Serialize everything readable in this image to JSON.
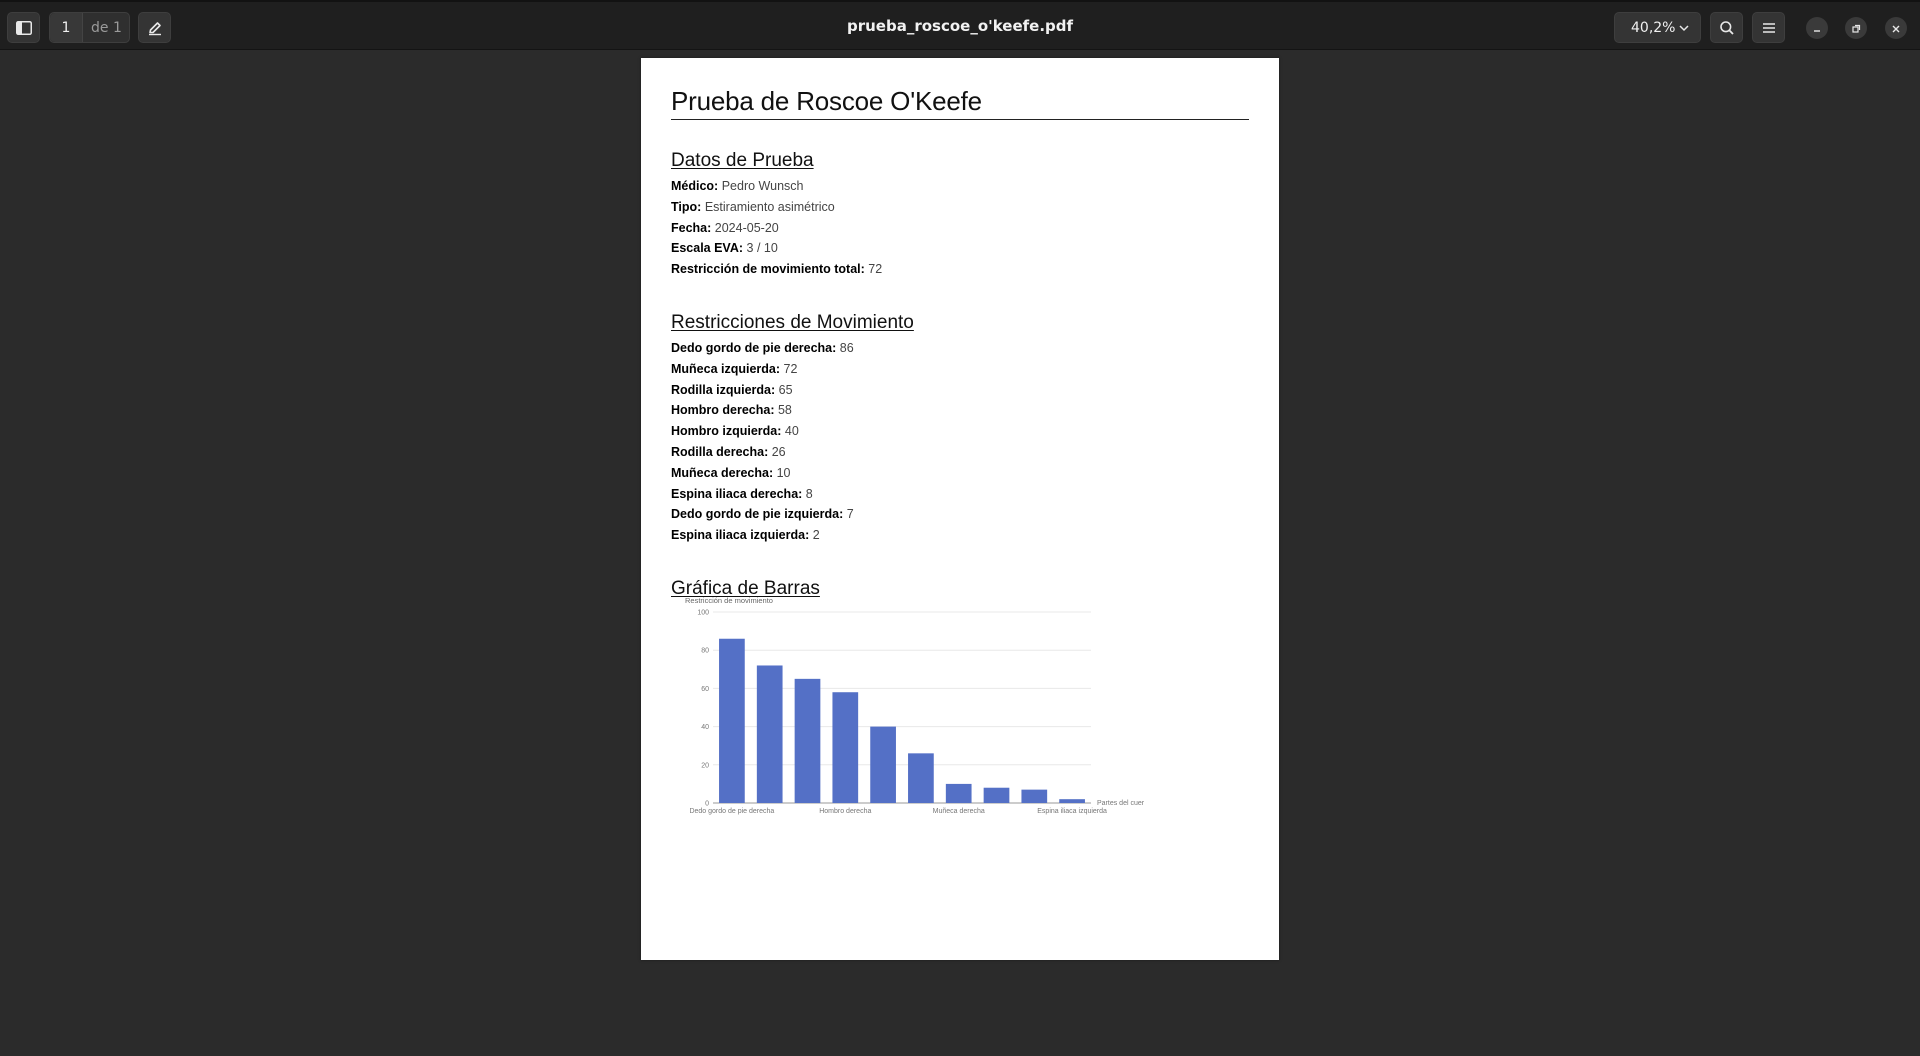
{
  "toolbar": {
    "page_current": "1",
    "page_of": "de 1",
    "title": "prueba_roscoe_o'keefe.pdf",
    "zoom": "40,2%"
  },
  "icons": [
    "sidebar-toggle-icon",
    "annotate-pen-icon",
    "chevron-down-icon",
    "search-icon",
    "menu-icon",
    "minimize-icon",
    "restore-icon",
    "close-icon"
  ],
  "document": {
    "title": "Prueba de Roscoe O'Keefe",
    "section_data": {
      "heading": "Datos de Prueba",
      "rows": [
        {
          "label": "Médico:",
          "value": "Pedro Wunsch"
        },
        {
          "label": "Tipo:",
          "value": "Estiramiento asimétrico"
        },
        {
          "label": "Fecha:",
          "value": "2024-05-20"
        },
        {
          "label": "Escala EVA:",
          "value": "3 / 10"
        },
        {
          "label": "Restricción de movimiento total:",
          "value": "72"
        }
      ]
    },
    "section_restrictions": {
      "heading": "Restricciones de Movimiento",
      "rows": [
        {
          "label": "Dedo gordo de pie derecha:",
          "value": "86"
        },
        {
          "label": "Muñeca izquierda:",
          "value": "72"
        },
        {
          "label": "Rodilla izquierda:",
          "value": "65"
        },
        {
          "label": "Hombro derecha:",
          "value": "58"
        },
        {
          "label": "Hombro izquierda:",
          "value": "40"
        },
        {
          "label": "Rodilla derecha:",
          "value": "26"
        },
        {
          "label": "Muñeca derecha:",
          "value": "10"
        },
        {
          "label": "Espina iliaca derecha:",
          "value": "8"
        },
        {
          "label": "Dedo gordo de pie izquierda:",
          "value": "7"
        },
        {
          "label": "Espina iliaca izquierda:",
          "value": "2"
        }
      ]
    },
    "section_chart": {
      "heading": "Gráfica de Barras"
    }
  },
  "chart_data": {
    "type": "bar",
    "title": "",
    "ylabel": "Restricción de movimiento",
    "xlabel": "Partes del cuer",
    "ylim": [
      0,
      100
    ],
    "yticks": [
      0,
      20,
      40,
      60,
      80,
      100
    ],
    "grid": true,
    "bar_color": "#5470c6",
    "categories": [
      "Dedo gordo de pie derecha",
      "Muñeca izquierda",
      "Rodilla izquierda",
      "Hombro derecha",
      "Hombro izquierda",
      "Rodilla derecha",
      "Muñeca derecha",
      "Espina iliaca derecha",
      "Dedo gordo de pie izquierda",
      "Espina iliaca izquierda"
    ],
    "shown_category_labels": [
      "Dedo gordo de pie derecha",
      "Hombro derecha",
      "Muñeca derecha",
      "Espina iliaca izquierda"
    ],
    "values": [
      86,
      72,
      65,
      58,
      40,
      26,
      10,
      8,
      7,
      2
    ]
  }
}
